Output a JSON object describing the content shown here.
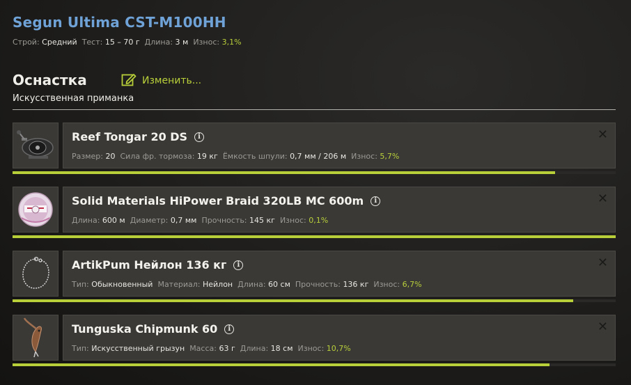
{
  "rod": {
    "title": "Segun Ultima CST-M100HH",
    "stats": [
      {
        "label": "Строй:",
        "value": "Средний"
      },
      {
        "label": "Тест:",
        "value": "15 – 70 г"
      },
      {
        "label": "Длина:",
        "value": "3 м"
      },
      {
        "label": "Износ:",
        "value": "3,1%",
        "accent": true
      }
    ]
  },
  "tackle": {
    "title": "Оснастка",
    "edit_label": "Изменить...",
    "subtitle": "Искусственная приманка"
  },
  "colors": {
    "accent": "#b8cf3a",
    "title": "#6fa3d8",
    "panel": "#3a3936"
  },
  "items": [
    {
      "name": "Reef Tongar 20 DS",
      "icon": "reel-icon",
      "condition": 0.9,
      "props": [
        {
          "label": "Размер:",
          "value": "20"
        },
        {
          "label": "Сила фр. тормоза:",
          "value": "19 кг"
        },
        {
          "label": "Ёмкость шпули:",
          "value": "0,7 мм / 206 м"
        },
        {
          "label": "Износ:",
          "value": "5,7%",
          "accent": true
        }
      ]
    },
    {
      "name": "Solid Materials HiPower Braid 320LB MC 600m",
      "icon": "line-spool-icon",
      "condition": 1.0,
      "props": [
        {
          "label": "Длина:",
          "value": "600 м"
        },
        {
          "label": "Диаметр:",
          "value": "0,7 мм"
        },
        {
          "label": "Прочность:",
          "value": "145 кг"
        },
        {
          "label": "Износ:",
          "value": "0,1%",
          "accent": true
        }
      ]
    },
    {
      "name": "ArtikPum Нейлон 136 кг",
      "icon": "leader-icon",
      "condition": 0.93,
      "props": [
        {
          "label": "Тип:",
          "value": "Обыкновенный"
        },
        {
          "label": "Материал:",
          "value": "Нейлон"
        },
        {
          "label": "Длина:",
          "value": "60 см"
        },
        {
          "label": "Прочность:",
          "value": "136 кг"
        },
        {
          "label": "Износ:",
          "value": "6,7%",
          "accent": true
        }
      ]
    },
    {
      "name": "Tunguska Chipmunk 60",
      "icon": "lure-icon",
      "condition": 0.89,
      "props": [
        {
          "label": "Тип:",
          "value": "Искусственный грызун"
        },
        {
          "label": "Масса:",
          "value": "63 г"
        },
        {
          "label": "Длина:",
          "value": "18 см"
        },
        {
          "label": "Износ:",
          "value": "10,7%",
          "accent": true
        }
      ]
    }
  ]
}
